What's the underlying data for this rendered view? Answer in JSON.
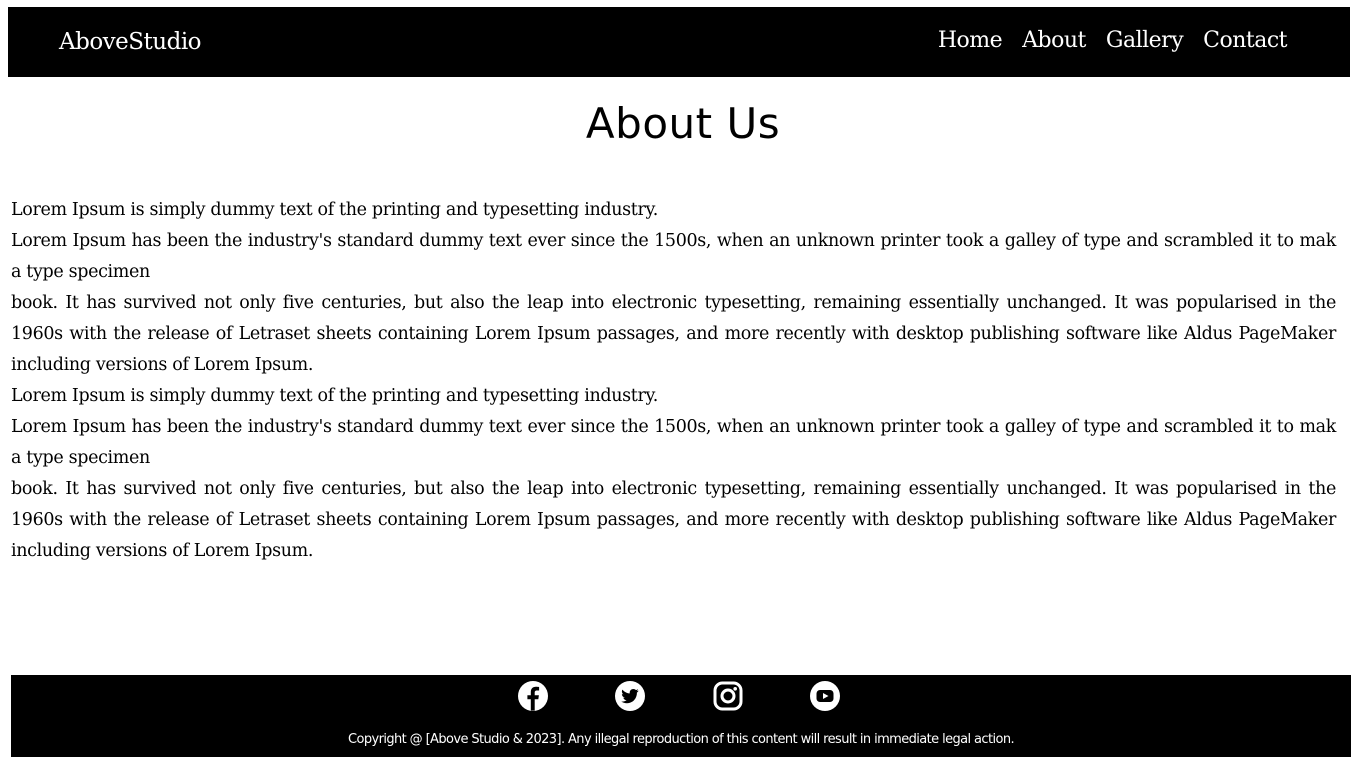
{
  "header": {
    "brand": "AboveStudio",
    "nav": [
      {
        "label": "Home"
      },
      {
        "label": "About"
      },
      {
        "label": "Gallery"
      },
      {
        "label": "Contact"
      }
    ]
  },
  "main": {
    "title": "About Us",
    "paragraphs": [
      "Lorem Ipsum is simply dummy text of the printing and typesetting industry.",
      "Lorem Ipsum has been the industry's standard dummy text ever since the 1500s, when an unknown printer took a galley of type and scrambled it to mak a type specimen",
      "book. It has survived not only five centuries, but also the leap into electronic typesetting, remaining essentially unchanged. It was popularised in the 1960s with the release of Letraset sheets containing Lorem Ipsum passages, and more recently with desktop publishing software like Aldus PageMaker including versions of Lorem Ipsum.",
      "Lorem Ipsum is simply dummy text of the printing and typesetting industry.",
      "Lorem Ipsum has been the industry's standard dummy text ever since the 1500s, when an unknown printer took a galley of type and scrambled it to mak a type specimen",
      "book. It has survived not only five centuries, but also the leap into electronic typesetting, remaining essentially unchanged. It was popularised in the 1960s with the release of Letraset sheets containing Lorem Ipsum passages, and more recently with desktop publishing software like Aldus PageMaker including versions of Lorem Ipsum."
    ]
  },
  "footer": {
    "social_icons": [
      "facebook-icon",
      "twitter-icon",
      "instagram-icon",
      "youtube-icon"
    ],
    "copyright": "Copyright @ [Above Studio & 2023]. Any illegal reproduction of this content will result in immediate legal action."
  },
  "colors": {
    "background": "#ffffff",
    "bar": "#000000",
    "text": "#000000",
    "bar_text": "#ffffff"
  }
}
